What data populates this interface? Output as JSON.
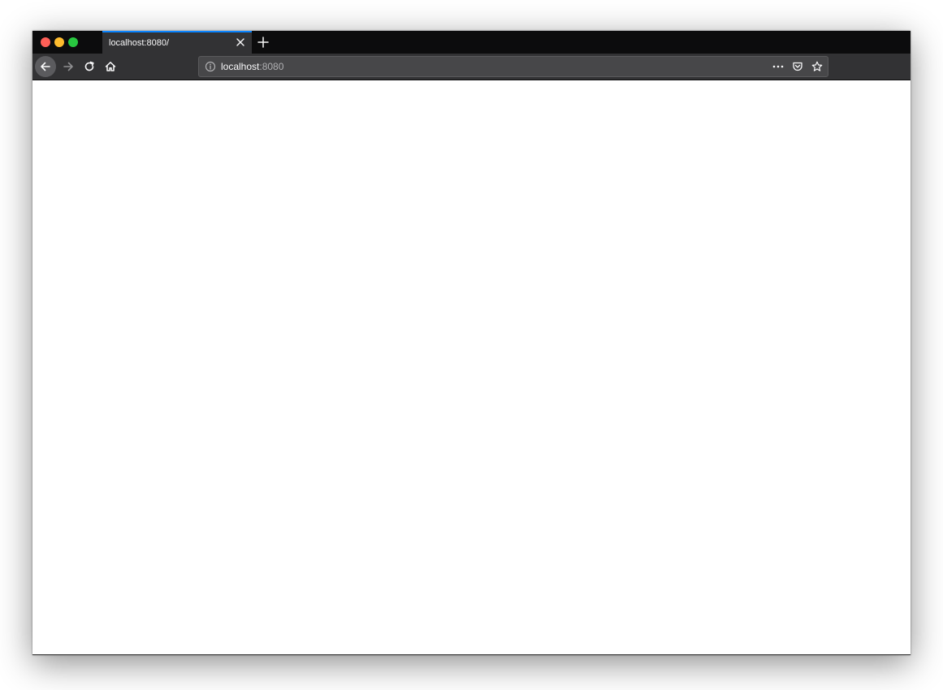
{
  "colors": {
    "tabbar_bg": "#0c0c0d",
    "toolbar_bg": "#323234",
    "urlbar_bg": "#474749",
    "active_tab_accent": "#0a84ff",
    "traffic_close": "#ff5f57",
    "traffic_minimize": "#febc2e",
    "traffic_maximize": "#28c840",
    "page_bg": "#ffffff"
  },
  "tabs": [
    {
      "title": "localhost:8080/",
      "active": true
    }
  ],
  "toolbar": {
    "back_icon": "arrow-left-icon",
    "forward_icon": "arrow-right-icon",
    "reload_icon": "reload-icon",
    "home_icon": "home-icon"
  },
  "urlbar": {
    "host": "localhost",
    "port": ":8080",
    "info_icon": "info-icon",
    "actions": [
      "more-icon",
      "pocket-icon",
      "bookmark-star-icon"
    ]
  }
}
